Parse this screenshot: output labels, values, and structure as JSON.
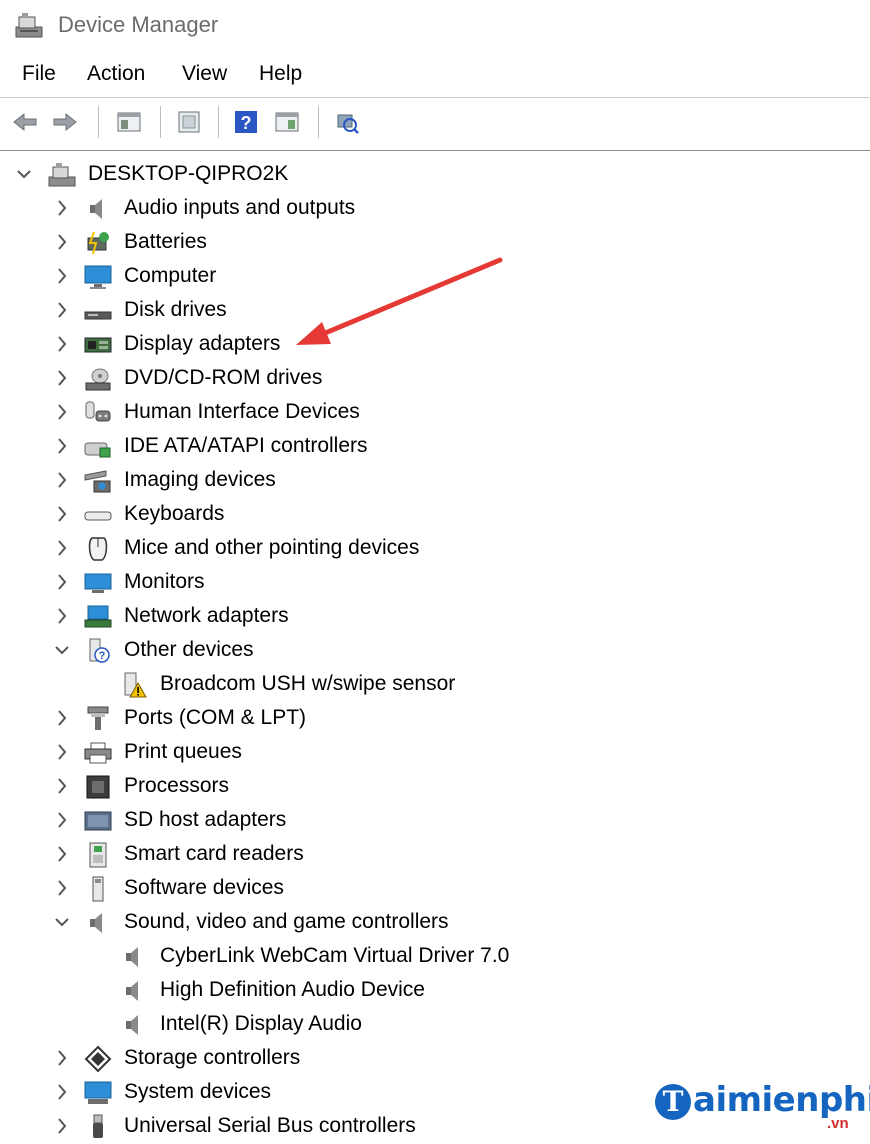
{
  "window": {
    "title": "Device Manager"
  },
  "menu": [
    "File",
    "Action",
    "View",
    "Help"
  ],
  "toolbar": {
    "buttons": [
      "back-arrow-icon",
      "forward-arrow-icon",
      "show-hide-console-tree-icon",
      "properties-icon",
      "help-icon",
      "action-pane-icon",
      "scan-hardware-icon"
    ]
  },
  "tree": {
    "root": "DESKTOP-QIPRO2K",
    "items": [
      {
        "label": "Audio inputs and outputs",
        "state": "collapsed",
        "icon": "speaker-icon"
      },
      {
        "label": "Batteries",
        "state": "collapsed",
        "icon": "battery-icon"
      },
      {
        "label": "Computer",
        "state": "collapsed",
        "icon": "computer-monitor-icon"
      },
      {
        "label": "Disk drives",
        "state": "collapsed",
        "icon": "disk-drive-icon"
      },
      {
        "label": "Display adapters",
        "state": "collapsed",
        "icon": "display-adapter-icon"
      },
      {
        "label": "DVD/CD-ROM drives",
        "state": "collapsed",
        "icon": "dvd-drive-icon"
      },
      {
        "label": "Human Interface Devices",
        "state": "collapsed",
        "icon": "hid-icon"
      },
      {
        "label": "IDE ATA/ATAPI controllers",
        "state": "collapsed",
        "icon": "ide-controller-icon"
      },
      {
        "label": "Imaging devices",
        "state": "collapsed",
        "icon": "camera-icon"
      },
      {
        "label": "Keyboards",
        "state": "collapsed",
        "icon": "keyboard-icon"
      },
      {
        "label": "Mice and other pointing devices",
        "state": "collapsed",
        "icon": "mouse-icon"
      },
      {
        "label": "Monitors",
        "state": "collapsed",
        "icon": "monitor-icon"
      },
      {
        "label": "Network adapters",
        "state": "collapsed",
        "icon": "network-adapter-icon"
      },
      {
        "label": "Other devices",
        "state": "expanded",
        "icon": "unknown-device-icon",
        "children": [
          {
            "label": "Broadcom USH w/swipe sensor",
            "icon": "warning-device-icon"
          }
        ]
      },
      {
        "label": "Ports (COM & LPT)",
        "state": "collapsed",
        "icon": "port-icon"
      },
      {
        "label": "Print queues",
        "state": "collapsed",
        "icon": "printer-icon"
      },
      {
        "label": "Processors",
        "state": "collapsed",
        "icon": "processor-icon"
      },
      {
        "label": "SD host adapters",
        "state": "collapsed",
        "icon": "sd-adapter-icon"
      },
      {
        "label": "Smart card readers",
        "state": "collapsed",
        "icon": "smart-card-icon"
      },
      {
        "label": "Software devices",
        "state": "collapsed",
        "icon": "software-device-icon"
      },
      {
        "label": "Sound, video and game controllers",
        "state": "expanded",
        "icon": "speaker-icon",
        "children": [
          {
            "label": "CyberLink WebCam Virtual Driver 7.0",
            "icon": "speaker-icon"
          },
          {
            "label": "High Definition Audio Device",
            "icon": "speaker-icon"
          },
          {
            "label": "Intel(R) Display Audio",
            "icon": "speaker-icon"
          }
        ]
      },
      {
        "label": "Storage controllers",
        "state": "collapsed",
        "icon": "storage-controller-icon"
      },
      {
        "label": "System devices",
        "state": "collapsed",
        "icon": "system-device-icon"
      },
      {
        "label": "Universal Serial Bus controllers",
        "state": "collapsed",
        "icon": "usb-icon"
      }
    ]
  },
  "annotation": {
    "arrow_color": "#e53935",
    "points_to": "Display adapters"
  },
  "watermark": {
    "letter": "T",
    "brand": "aimienphi",
    "tld": ".vn",
    "color": "#1565c0",
    "tld_color": "#d32f2f"
  }
}
